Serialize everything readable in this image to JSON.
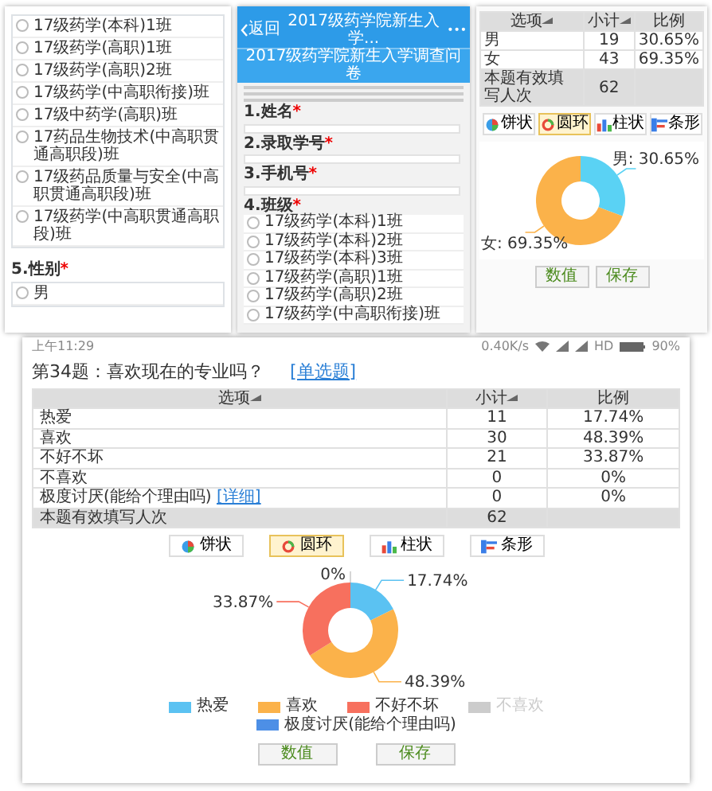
{
  "left_panel": {
    "options": [
      {
        "label": "17级药学(本科)1班",
        "selected": false
      },
      {
        "label": "17级药学(高职)1班",
        "selected": false
      },
      {
        "label": "17级药学(高职)2班",
        "selected": false
      },
      {
        "label": "17级药学(中高职衔接)班",
        "selected": false
      },
      {
        "label": "17级中药学(高职)班",
        "selected": false
      },
      {
        "label": "17药品生物技术(中高职贯通高职段)班",
        "selected": false
      },
      {
        "label": "17级药品质量与安全(中高职贯通高职段)班",
        "selected": false
      },
      {
        "label": "17级药学(中高职贯通高职段)班",
        "selected": false
      }
    ],
    "question": {
      "title": "5.性别",
      "required_mark": "*"
    },
    "next_options": [
      {
        "label": "男",
        "selected": false
      }
    ]
  },
  "phone_panel": {
    "back_label": "返回",
    "nav_title": "2017级药学院新生入学...",
    "menu": "•••",
    "header": "2017级药学院新生入学调查问卷",
    "fields": [
      {
        "title": "1.姓名",
        "required_mark": "*"
      },
      {
        "title": "2.录取学号",
        "required_mark": "*"
      },
      {
        "title": "3.手机号",
        "required_mark": "*"
      }
    ],
    "question": {
      "title": "4.班级",
      "required_mark": "*"
    },
    "options": [
      {
        "label": "17级药学(本科)1班",
        "selected": false
      },
      {
        "label": "17级药学(本科)2班",
        "selected": false
      },
      {
        "label": "17级药学(本科)3班",
        "selected": false
      },
      {
        "label": "17级药学(高职)1班",
        "selected": false
      },
      {
        "label": "17级药学(高职)2班",
        "selected": false
      },
      {
        "label": "17级药学(中高职衔接)班",
        "selected": false
      }
    ]
  },
  "stats_panel": {
    "columns": [
      {
        "label": "选项",
        "sortable": true
      },
      {
        "label": "小计",
        "sortable": true
      },
      {
        "label": "比例",
        "sortable": false
      }
    ],
    "rows": [
      {
        "option": "男",
        "count": "19",
        "percent": "30.65%"
      },
      {
        "option": "女",
        "count": "43",
        "percent": "69.35%"
      }
    ],
    "total": {
      "label": "本题有效填写人次",
      "count": "62"
    },
    "chart_types": [
      {
        "label": "饼状",
        "kind": "pie",
        "selected": false
      },
      {
        "label": "圆环",
        "kind": "ring",
        "selected": true
      },
      {
        "label": "柱状",
        "kind": "bar",
        "selected": false
      },
      {
        "label": "条形",
        "kind": "hbar",
        "selected": false
      }
    ],
    "chart_data": {
      "type": "donut",
      "values": [
        30.65,
        69.35
      ],
      "value_labels": [
        "男: 30.65%",
        "女: 69.35%"
      ]
    },
    "segments": [
      {
        "color": "#5ad2f4"
      },
      {
        "color": "#fbb24a"
      }
    ],
    "buttons": [
      "数值",
      "保存"
    ]
  },
  "result_panel": {
    "status_bar": {
      "time": "上午11:29",
      "speed": "0.40K/s",
      "network": "HD",
      "battery": "90%"
    },
    "question": "第34题：喜欢现在的专业吗？",
    "question_type": "[单选题]",
    "columns": [
      {
        "label": "选项",
        "sortable": true
      },
      {
        "label": "小计",
        "sortable": true
      },
      {
        "label": "比例",
        "sortable": false
      }
    ],
    "rows": [
      {
        "option": "热爱",
        "count": "11",
        "percent": "17.74%"
      },
      {
        "option": "喜欢",
        "count": "30",
        "percent": "48.39%"
      },
      {
        "option": "不好不坏",
        "count": "21",
        "percent": "33.87%"
      },
      {
        "option": "不喜欢",
        "count": "0",
        "percent": "0%"
      },
      {
        "option": "极度讨厌(能给个理由吗)",
        "detail_link": "[详细]",
        "count": "0",
        "percent": "0%"
      }
    ],
    "total": {
      "label": "本题有效填写人次",
      "count": "62"
    },
    "chart_types": [
      {
        "label": "饼状",
        "kind": "pie",
        "selected": false
      },
      {
        "label": "圆环",
        "kind": "ring",
        "selected": true
      },
      {
        "label": "柱状",
        "kind": "bar",
        "selected": false
      },
      {
        "label": "条形",
        "kind": "hbar",
        "selected": false
      }
    ],
    "chart_data": {
      "type": "donut",
      "categories": [
        "热爱",
        "喜欢",
        "不好不坏",
        "不喜欢",
        "极度讨厌(能给个理由吗)"
      ],
      "values": [
        17.74,
        48.39,
        33.87,
        0,
        0
      ],
      "value_labels": [
        "17.74%",
        "48.39%",
        "33.87%",
        "0%",
        null
      ]
    },
    "legend": [
      {
        "color": "#5bc2f2",
        "enabled": true
      },
      {
        "color": "#fbb24a",
        "enabled": true
      },
      {
        "color": "#f7705e",
        "enabled": true
      },
      {
        "color": "#cccccc",
        "enabled": false
      },
      {
        "color": "#4d8fe6",
        "enabled": true
      }
    ],
    "buttons": [
      "数值",
      "保存"
    ]
  }
}
